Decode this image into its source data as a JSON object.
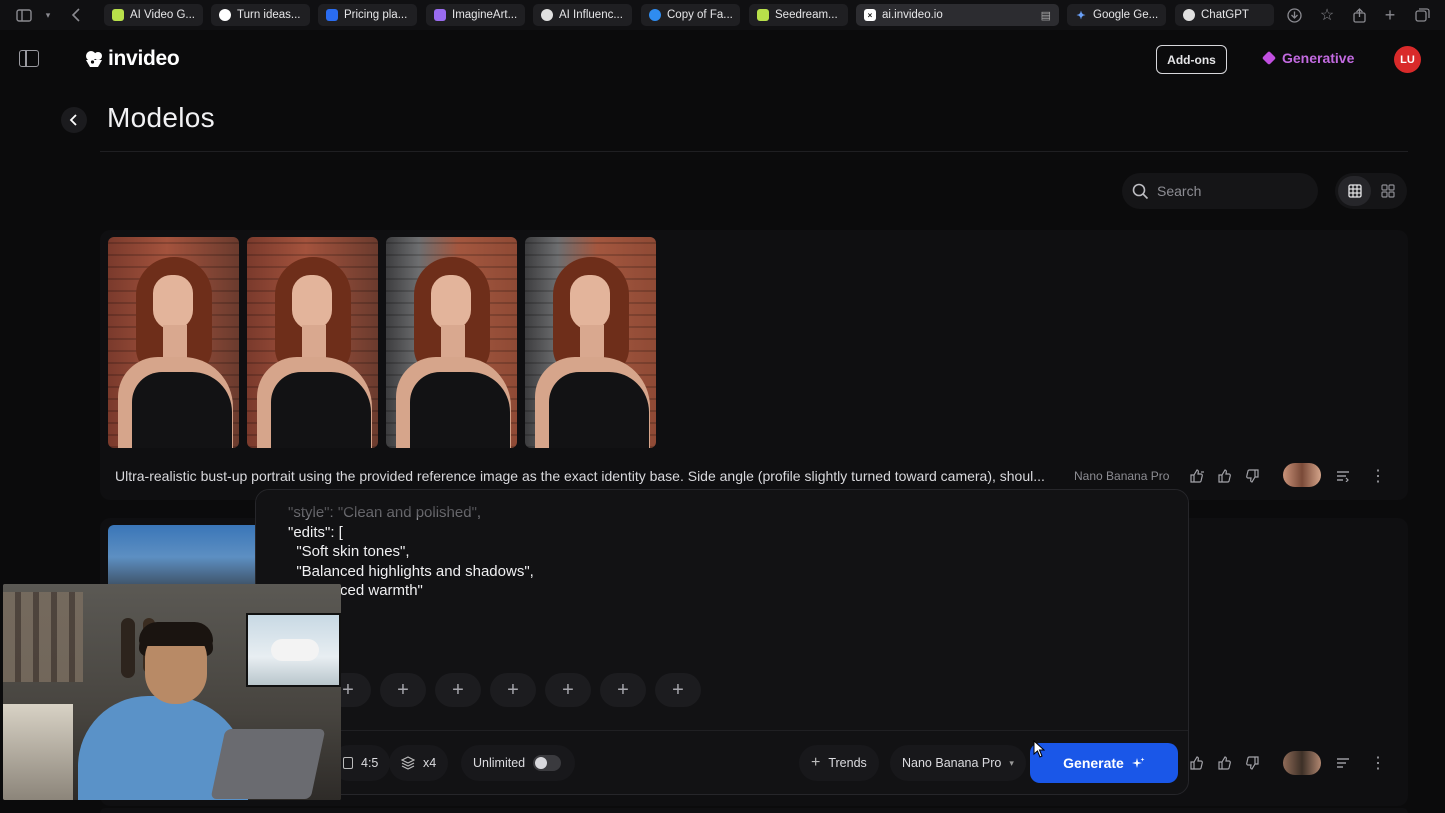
{
  "browser": {
    "tabs": [
      {
        "label": "AI Video G...",
        "icon": "invideo-favicon",
        "color": "#b8e04a"
      },
      {
        "label": "Turn ideas...",
        "icon": "chat-favicon",
        "color": "#ffffff"
      },
      {
        "label": "Pricing pla...",
        "icon": "doc-favicon",
        "color": "#2a6cf0"
      },
      {
        "label": "ImagineArt...",
        "icon": "imagineart-favicon",
        "color": "#9a6cf0"
      },
      {
        "label": "AI Influenc...",
        "icon": "openai-favicon",
        "color": "#e0e0e0"
      },
      {
        "label": "Copy of Fa...",
        "icon": "canva-favicon",
        "color": "#2f8cf0"
      },
      {
        "label": "Seedream...",
        "icon": "invideo-favicon",
        "color": "#b8e04a"
      },
      {
        "label": "ai.invideo.io",
        "icon": "close-favicon",
        "color": "#ffffff"
      },
      {
        "label": "Google Ge...",
        "icon": "gemini-favicon",
        "color": "#6aa0f8"
      },
      {
        "label": "ChatGPT",
        "icon": "openai-favicon",
        "color": "#e0e0e0"
      }
    ]
  },
  "header": {
    "logo_text": "invideo",
    "addons_label": "Add-ons",
    "plan_label": "Generative",
    "avatar_initials": "LU"
  },
  "page": {
    "title": "Modelos",
    "search_placeholder": "Search"
  },
  "results": [
    {
      "prompt": "Ultra-realistic bust-up portrait using the provided reference image as the exact identity base. Side angle (profile slightly turned toward camera), shoul...",
      "model": "Nano Banana Pro"
    }
  ],
  "composer": {
    "text_lines": [
      "\"style\": \"Clean and polished\",",
      "\"edits\": [",
      "  \"Soft skin tones\",",
      "  \"Balanced highlights and shadows\",",
      "  \"Balanced warmth\""
    ],
    "aspect_ratio": "4:5",
    "count": "x4",
    "unlimited_label": "Unlimited",
    "unlimited_on": false,
    "trends_label": "Trends",
    "model_label": "Nano Banana Pro",
    "generate_label": "Generate"
  },
  "colors": {
    "accent": "#1a57e8",
    "plan": "#c26ae0",
    "avatar": "#d92a2a"
  }
}
